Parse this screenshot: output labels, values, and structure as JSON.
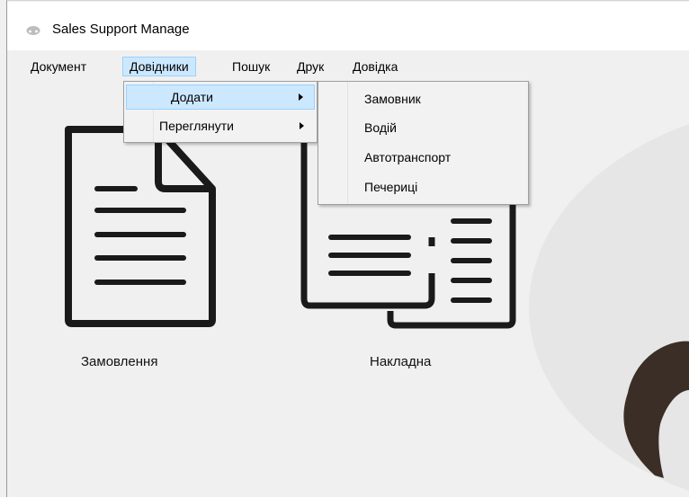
{
  "window": {
    "title": "Sales Support Manage"
  },
  "menubar": {
    "items": [
      {
        "label": "Документ"
      },
      {
        "label": "Довідники"
      },
      {
        "label": "Пошук"
      },
      {
        "label": "Друк"
      },
      {
        "label": "Довідка"
      }
    ]
  },
  "submenu_dovidnyky": {
    "items": [
      {
        "label": "Додати"
      },
      {
        "label": "Переглянути"
      }
    ]
  },
  "submenu_dodaty": {
    "items": [
      {
        "label": "Замовник"
      },
      {
        "label": "Водій"
      },
      {
        "label": "Автотранспорт"
      },
      {
        "label": "Печериці"
      }
    ]
  },
  "content": {
    "order_label": "Замовлення",
    "invoice_label": "Накладна"
  },
  "colors": {
    "highlight": "#cce8ff",
    "highlight_border": "#99d1ff",
    "icon_stroke": "#1a1a1a",
    "mushroom_cap": "#3a2e27"
  },
  "icons": [
    "app-icon",
    "document-icon",
    "invoice-icon",
    "submenu-arrow-icon"
  ]
}
